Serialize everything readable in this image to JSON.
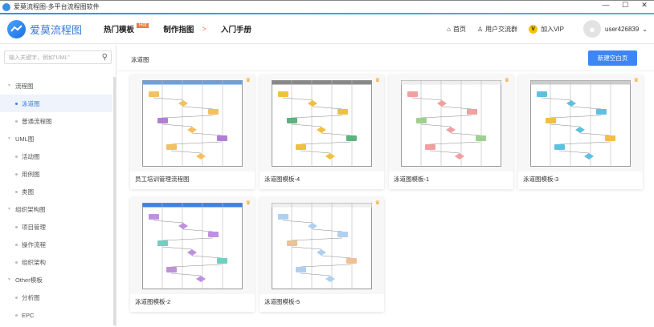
{
  "window": {
    "title": "爱莫流程图-多平台流程图软件",
    "minimize": "—",
    "maximize": "☐",
    "close": "✕"
  },
  "header": {
    "logo": "爱莫流程图",
    "nav": [
      {
        "label": "热门模板",
        "badge": "Hot"
      },
      {
        "label": "制作指图"
      },
      {
        "label": "入门手册"
      }
    ],
    "links": {
      "home": "首页",
      "community": "用户交流群",
      "vip": "加入VIP",
      "user": "user426839"
    }
  },
  "sidebar": {
    "search_placeholder": "输入关键字，例如\"UML\"",
    "groups": [
      {
        "label": "流程图",
        "items": [
          "泳道图",
          "普通流程图"
        ]
      },
      {
        "label": "UML图",
        "items": [
          "活动图",
          "用例图",
          "类图"
        ]
      },
      {
        "label": "组织架构图",
        "items": [
          "项目管理",
          "操作流程",
          "组织架构"
        ]
      },
      {
        "label": "Other模板",
        "items": [
          "分析图",
          "EPC"
        ]
      }
    ]
  },
  "main": {
    "breadcrumb": "泳道图",
    "new_button": "新建空白页",
    "cards": [
      {
        "label": "员工培训管理流程图"
      },
      {
        "label": "泳道图模板-4"
      },
      {
        "label": "泳道图模板-1"
      },
      {
        "label": "泳道图模板-3"
      },
      {
        "label": "泳道图模板-2"
      },
      {
        "label": "泳道图模板-5"
      }
    ]
  }
}
